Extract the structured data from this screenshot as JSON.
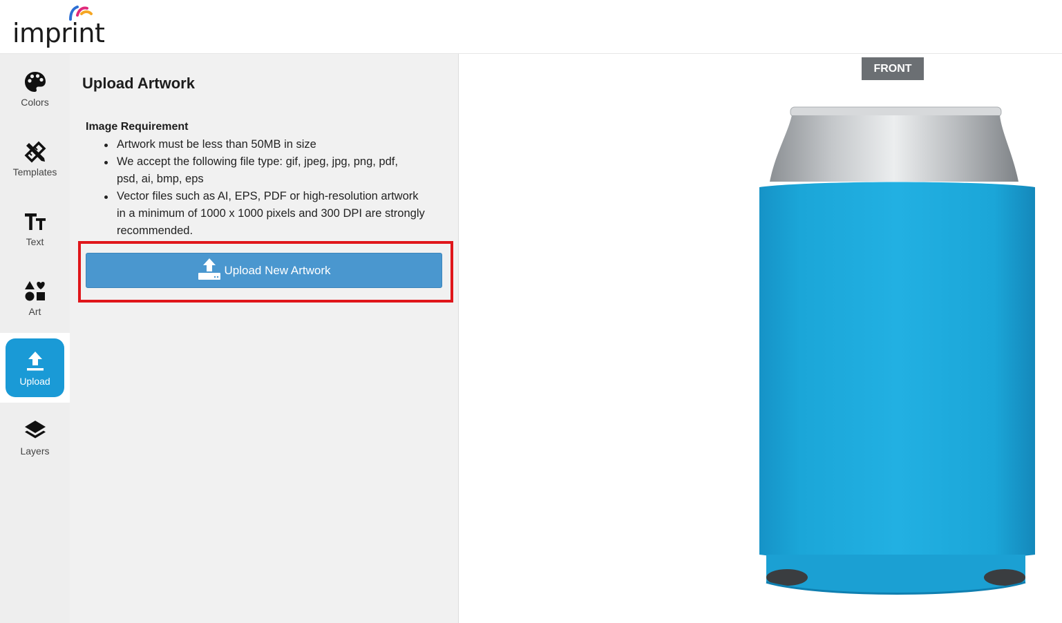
{
  "brand": {
    "logo_text": "imprint"
  },
  "sidebar": {
    "items": [
      {
        "label": "Colors",
        "icon": "palette-icon",
        "active": false
      },
      {
        "label": "Templates",
        "icon": "templates-icon",
        "active": false
      },
      {
        "label": "Text",
        "icon": "text-icon",
        "active": false
      },
      {
        "label": "Art",
        "icon": "shapes-icon",
        "active": false
      },
      {
        "label": "Upload",
        "icon": "upload-icon",
        "active": true
      },
      {
        "label": "Layers",
        "icon": "layers-icon",
        "active": false
      }
    ],
    "active_color": "#1a9ad6"
  },
  "panel": {
    "title": "Upload Artwork",
    "requirements_title": "Image Requirement",
    "requirements": [
      "Artwork must be less than 50MB in size",
      "We accept the following file type: gif, jpeg, jpg, png, pdf, psd, ai, bmp, eps",
      "Vector files such as AI, EPS, PDF or high-resolution artwork in a minimum of 1000 x 1000 pixels and 300 DPI are strongly recommended."
    ],
    "upload_button_label": "Upload New Artwork",
    "upload_button_color": "#4a97cf",
    "highlight_color": "#e0161b"
  },
  "preview": {
    "side_label": "FRONT",
    "product_color": "#1ba6d8"
  }
}
